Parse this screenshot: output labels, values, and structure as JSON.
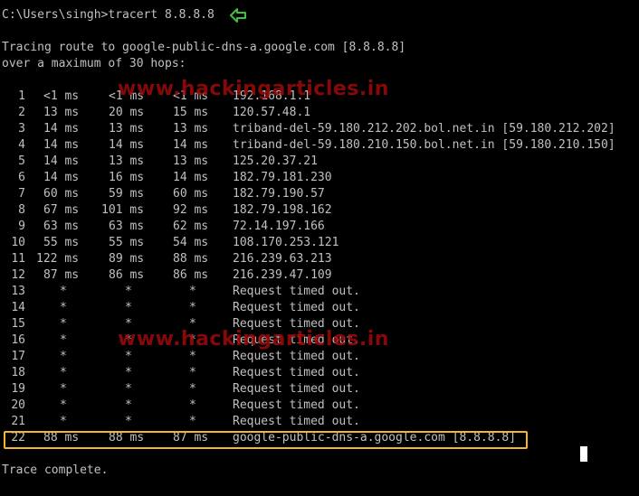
{
  "prompt": {
    "command_line": "C:\\Users\\singh>tracert 8.8.8.8"
  },
  "tracing": {
    "line1": "Tracing route to google-public-dns-a.google.com [8.8.8.8]",
    "line2": "over a maximum of 30 hops:"
  },
  "hops": [
    {
      "hop": "1",
      "r1": "<1 ms",
      "r2": "<1 ms",
      "r3": "<1 ms",
      "host": "192.168.1.1"
    },
    {
      "hop": "2",
      "r1": "13 ms",
      "r2": "20 ms",
      "r3": "15 ms",
      "host": "120.57.48.1"
    },
    {
      "hop": "3",
      "r1": "14 ms",
      "r2": "13 ms",
      "r3": "13 ms",
      "host": "triband-del-59.180.212.202.bol.net.in [59.180.212.202]"
    },
    {
      "hop": "4",
      "r1": "14 ms",
      "r2": "14 ms",
      "r3": "14 ms",
      "host": "triband-del-59.180.210.150.bol.net.in [59.180.210.150]"
    },
    {
      "hop": "5",
      "r1": "14 ms",
      "r2": "13 ms",
      "r3": "13 ms",
      "host": "125.20.37.21"
    },
    {
      "hop": "6",
      "r1": "14 ms",
      "r2": "16 ms",
      "r3": "14 ms",
      "host": "182.79.181.230"
    },
    {
      "hop": "7",
      "r1": "60 ms",
      "r2": "59 ms",
      "r3": "60 ms",
      "host": "182.79.190.57"
    },
    {
      "hop": "8",
      "r1": "67 ms",
      "r2": "101 ms",
      "r3": "92 ms",
      "host": "182.79.198.162"
    },
    {
      "hop": "9",
      "r1": "63 ms",
      "r2": "63 ms",
      "r3": "62 ms",
      "host": "72.14.197.166"
    },
    {
      "hop": "10",
      "r1": "55 ms",
      "r2": "55 ms",
      "r3": "54 ms",
      "host": "108.170.253.121"
    },
    {
      "hop": "11",
      "r1": "122 ms",
      "r2": "89 ms",
      "r3": "88 ms",
      "host": "216.239.63.213"
    },
    {
      "hop": "12",
      "r1": "87 ms",
      "r2": "86 ms",
      "r3": "86 ms",
      "host": "216.239.47.109"
    },
    {
      "hop": "13",
      "r1": "*",
      "r2": "*",
      "r3": "*",
      "host": "Request timed out."
    },
    {
      "hop": "14",
      "r1": "*",
      "r2": "*",
      "r3": "*",
      "host": "Request timed out."
    },
    {
      "hop": "15",
      "r1": "*",
      "r2": "*",
      "r3": "*",
      "host": "Request timed out."
    },
    {
      "hop": "16",
      "r1": "*",
      "r2": "*",
      "r3": "*",
      "host": "Request timed out."
    },
    {
      "hop": "17",
      "r1": "*",
      "r2": "*",
      "r3": "*",
      "host": "Request timed out."
    },
    {
      "hop": "18",
      "r1": "*",
      "r2": "*",
      "r3": "*",
      "host": "Request timed out."
    },
    {
      "hop": "19",
      "r1": "*",
      "r2": "*",
      "r3": "*",
      "host": "Request timed out."
    },
    {
      "hop": "20",
      "r1": "*",
      "r2": "*",
      "r3": "*",
      "host": "Request timed out."
    },
    {
      "hop": "21",
      "r1": "*",
      "r2": "*",
      "r3": "*",
      "host": "Request timed out."
    },
    {
      "hop": "22",
      "r1": "88 ms",
      "r2": "88 ms",
      "r3": "87 ms",
      "host": "google-public-dns-a.google.com [8.8.8.8]"
    }
  ],
  "footer": {
    "complete": "Trace complete."
  },
  "watermark": {
    "text": "www.hackingarticles.in"
  },
  "icons": {
    "arrow": "left-arrow-icon",
    "cursor": "text-cursor"
  },
  "colors": {
    "background": "#000000",
    "text": "#c0c0c0",
    "arrow": "#3fbf3f",
    "highlight_border": "#f5b52e",
    "watermark": "#9e0a0a",
    "cursor": "#ffffff"
  }
}
